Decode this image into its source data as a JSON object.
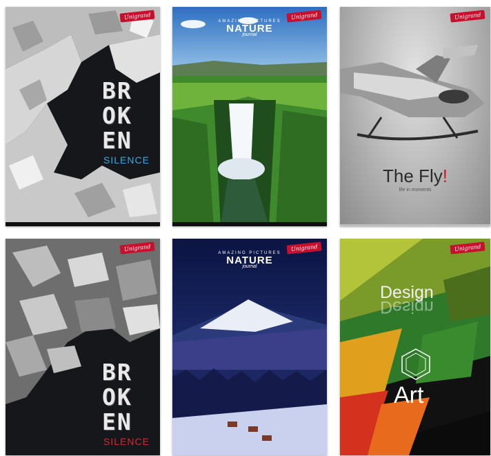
{
  "brand_logo": "Unigrand",
  "notebooks": [
    {
      "id": "broken-1",
      "title_lines": [
        "BR",
        "OK",
        "EN"
      ],
      "subtitle": "SILENCE",
      "subtitle_color": "#3fa8e0"
    },
    {
      "id": "nature-1",
      "header_small": "AMAZING PICTURES",
      "header_big": "NATURE",
      "header_script": "journal"
    },
    {
      "id": "fly",
      "title": "The Fly",
      "title_mark": "!",
      "subtitle": "life in moments"
    },
    {
      "id": "broken-2",
      "title_lines": [
        "BR",
        "OK",
        "EN"
      ],
      "subtitle": "SILENCE",
      "subtitle_color": "#d9272e"
    },
    {
      "id": "nature-2",
      "header_small": "AMAZING PICTURES",
      "header_big": "NATURE",
      "header_script": "journal"
    },
    {
      "id": "design",
      "title": "Design",
      "title_reflection": "Design",
      "subtitle": "Art"
    }
  ]
}
